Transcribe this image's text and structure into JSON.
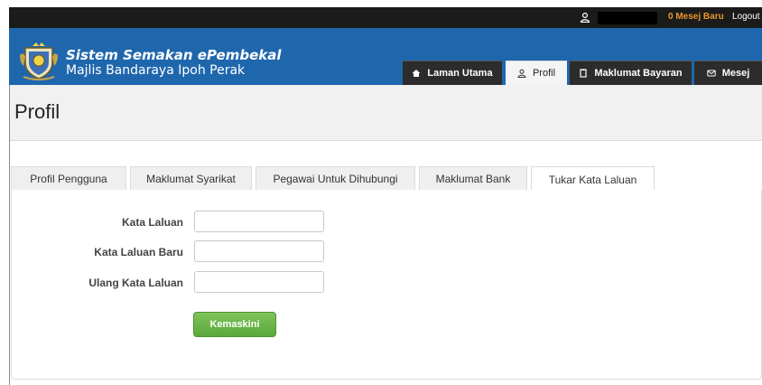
{
  "topbar": {
    "user_icon": "user-icon",
    "messages_label": "0 Mesej Baru",
    "logout_label": "Logout"
  },
  "header": {
    "logo": "city-crest-logo",
    "title_line1": "Sistem Semakan ePembekal",
    "title_line2": "Majlis Bandaraya Ipoh Perak"
  },
  "nav": {
    "items": [
      {
        "label": "Laman Utama",
        "icon": "home-icon"
      },
      {
        "label": "Profil",
        "icon": "user-icon",
        "active": true
      },
      {
        "label": "Maklumat Bayaran",
        "icon": "document-icon"
      },
      {
        "label": "Mesej",
        "icon": "envelope-icon"
      }
    ]
  },
  "page": {
    "title": "Profil"
  },
  "tabs": [
    {
      "label": "Profil Pengguna"
    },
    {
      "label": "Maklumat Syarikat"
    },
    {
      "label": "Pegawai Untuk Dihubungi"
    },
    {
      "label": "Maklumat Bank"
    },
    {
      "label": "Tukar Kata Laluan",
      "active": true
    }
  ],
  "form": {
    "password_label": "Kata Laluan",
    "password_value": "",
    "new_password_label": "Kata Laluan Baru",
    "new_password_value": "",
    "confirm_password_label": "Ulang Kata Laluan",
    "confirm_password_value": "",
    "submit_label": "Kemaskini"
  },
  "colors": {
    "header_bg": "#1f67ad",
    "topbar_bg": "#1b1b1b",
    "nav_bg": "#2c2c2c",
    "message_accent": "#e8962b",
    "button_green": "#5aa83a"
  }
}
